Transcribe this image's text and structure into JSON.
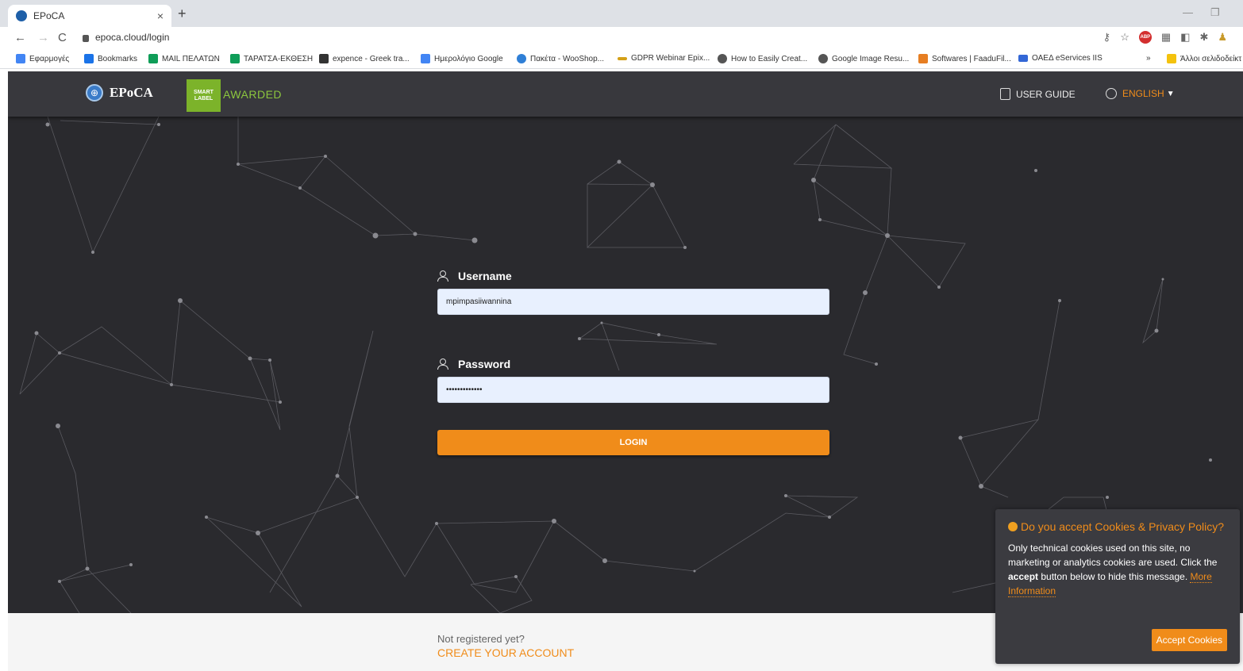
{
  "browser": {
    "tab_title": "EPoCA",
    "tab_close": "×",
    "new_tab": "+",
    "url": "epoca.cloud/login",
    "bookmarks": [
      {
        "label": "Εφαρμογές",
        "color": "#4285f4"
      },
      {
        "label": "Bookmarks",
        "color": "#1a73e8"
      },
      {
        "label": "MAIL ΠΕΛΑΤΩΝ",
        "color": "#0f9d58"
      },
      {
        "label": "ΤΑΡΑΤΣΑ-ΕΚΘΕΣΗ",
        "color": "#0f9d58"
      },
      {
        "label": "expence - Greek tra...",
        "color": "#333333"
      },
      {
        "label": "Ημερολόγιο Google",
        "color": "#4285f4"
      },
      {
        "label": "Πακέτα - WooShop...",
        "color": "#2f7fd6"
      },
      {
        "label": "GDPR Webinar Epix...",
        "color": "#d4a017"
      },
      {
        "label": "How to Easily Creat...",
        "color": "#555555"
      },
      {
        "label": "Google Image Resu...",
        "color": "#555555"
      },
      {
        "label": "Softwares | FaaduFil...",
        "color": "#e67e22"
      },
      {
        "label": "ΟΑΕΔ eServices IIS",
        "color": "#3367d6"
      }
    ],
    "bookmarks_more": "»",
    "other_bookmarks": "Άλλοι σελιδοδείκτ"
  },
  "header": {
    "logo_text": "EPoCA",
    "smart_label": "SMART LABEL",
    "awarded": "AWARDED",
    "user_guide": "USER GUIDE",
    "language": "ENGLISH"
  },
  "login": {
    "username_label": "Username",
    "username_value": "mpimpasiiwannina",
    "password_label": "Password",
    "password_value": "•••••••••••••",
    "login_button": "LOGIN"
  },
  "footer": {
    "not_registered": "Not registered yet?",
    "create_account": "CREATE YOUR ACCOUNT"
  },
  "cookie": {
    "title": "Do you accept Cookies & Privacy Policy?",
    "text_before": "Only technical cookies used on this site, no marketing or analytics cookies are used. Click the ",
    "accept_word": "accept",
    "text_after": " button below to hide this message. ",
    "more_info": "More Information",
    "accept_button": "Accept Cookies"
  },
  "colors": {
    "accent": "#f08c1a",
    "awarded_green": "#8cc63e",
    "hero_bg": "#2a2a2e"
  }
}
